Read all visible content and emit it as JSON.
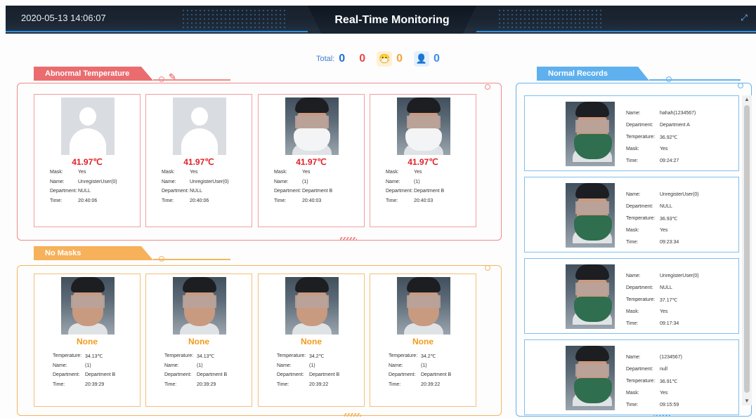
{
  "header": {
    "datetime": "2020-05-13 14:06:07",
    "title": "Real-Time Monitoring",
    "fullscreen_icon": "fullscreen-icon"
  },
  "summary": {
    "total_label": "Total:",
    "total_value": "0",
    "abnormal_temp_count": "0",
    "no_mask_count": "0",
    "normal_count": "0"
  },
  "sections": {
    "abnormal": "Abnormal Temperature",
    "no_masks": "No Masks",
    "normal": "Normal Records"
  },
  "colors": {
    "abnormal": "#e8474a",
    "no_masks": "#f3a33a",
    "normal": "#3b8fe6"
  },
  "abnormal_cards": [
    {
      "photo": "placeholder",
      "temperature": "41.97℃",
      "mask_label": "Mask:",
      "mask": "Yes",
      "name_label": "Name:",
      "name": "UnregisterUser(0)",
      "dept_label": "Department:",
      "department": "NULL",
      "time_label": "Time:",
      "time": "20:40:06"
    },
    {
      "photo": "placeholder",
      "temperature": "41.97℃",
      "mask_label": "Mask:",
      "mask": "Yes",
      "name_label": "Name:",
      "name": "UnregisterUser(0)",
      "dept_label": "Department:",
      "department": "NULL",
      "time_label": "Time:",
      "time": "20:40:06"
    },
    {
      "photo": "face-white-mask",
      "temperature": "41.97℃",
      "mask_label": "Mask:",
      "mask": "Yes",
      "name_label": "Name:",
      "name": "(1)",
      "dept_label": "Department:",
      "department": "Department B",
      "time_label": "Time:",
      "time": "20:40:03"
    },
    {
      "photo": "face-white-mask",
      "temperature": "41.97℃",
      "mask_label": "Mask:",
      "mask": "Yes",
      "name_label": "Name:",
      "name": "(1)",
      "dept_label": "Department:",
      "department": "Department B",
      "time_label": "Time:",
      "time": "20:40:03"
    }
  ],
  "mask_cards": [
    {
      "photo": "face-no-mask",
      "mask_status": "None",
      "temp_label": "Temperature:",
      "temperature": "34.13℃",
      "name_label": "Name:",
      "name": "(1)",
      "dept_label": "Department:",
      "department": "Department B",
      "time_label": "Time:",
      "time": "20:39:29"
    },
    {
      "photo": "face-no-mask",
      "mask_status": "None",
      "temp_label": "Temperature:",
      "temperature": "34.13℃",
      "name_label": "Name:",
      "name": "(1)",
      "dept_label": "Department:",
      "department": "Department B",
      "time_label": "Time:",
      "time": "20:39:29"
    },
    {
      "photo": "face-no-mask",
      "mask_status": "None",
      "temp_label": "Temperature:",
      "temperature": "34.2℃",
      "name_label": "Name:",
      "name": "(1)",
      "dept_label": "Department:",
      "department": "Department B",
      "time_label": "Time:",
      "time": "20:39:22"
    },
    {
      "photo": "face-no-mask",
      "mask_status": "None",
      "temp_label": "Temperature:",
      "temperature": "34.2℃",
      "name_label": "Name:",
      "name": "(1)",
      "dept_label": "Department:",
      "department": "Department B",
      "time_label": "Time:",
      "time": "20:39:22"
    }
  ],
  "normal_records": [
    {
      "name_label": "Name:",
      "name": "hahah(1234567)",
      "dept_label": "Department:",
      "department": "Department A",
      "temp_label": "Temperature:",
      "temperature": "36.92℃",
      "mask_label": "Mask:",
      "mask": "Yes",
      "time_label": "Time:",
      "time": "09:24:27"
    },
    {
      "name_label": "Name:",
      "name": "UnregisterUser(0)",
      "dept_label": "Department:",
      "department": "NULL",
      "temp_label": "Temperature:",
      "temperature": "36.93℃",
      "mask_label": "Mask:",
      "mask": "Yes",
      "time_label": "Time:",
      "time": "09:23:34"
    },
    {
      "name_label": "Name:",
      "name": "UnregisterUser(0)",
      "dept_label": "Department:",
      "department": "NULL",
      "temp_label": "Temperature:",
      "temperature": "37.17℃",
      "mask_label": "Mask:",
      "mask": "Yes",
      "time_label": "Time:",
      "time": "09:17:34"
    },
    {
      "name_label": "Name:",
      "name": "(1234567)",
      "dept_label": "Department:",
      "department": "null",
      "temp_label": "Temperature:",
      "temperature": "36.91℃",
      "mask_label": "Mask:",
      "mask": "Yes",
      "time_label": "Time:",
      "time": "09:15:59"
    }
  ]
}
